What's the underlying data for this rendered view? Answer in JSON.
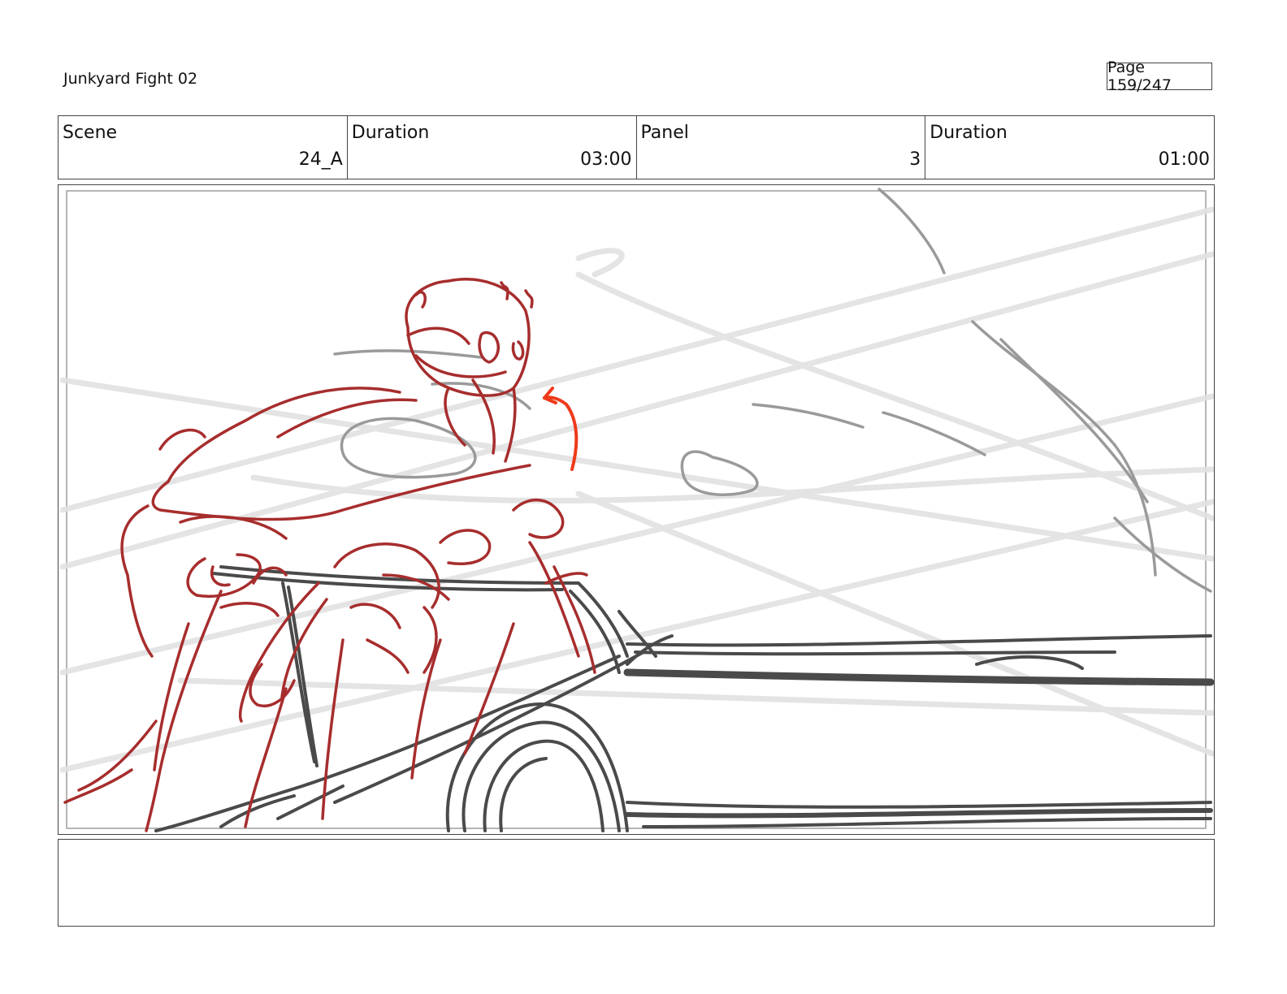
{
  "header": {
    "title": "Junkyard Fight 02",
    "page": "Page 159/247"
  },
  "info": {
    "scene_label": "Scene",
    "scene_value": "24_A",
    "scene_duration_label": "Duration",
    "scene_duration_value": "03:00",
    "panel_label": "Panel",
    "panel_value": "3",
    "panel_duration_label": "Duration",
    "panel_duration_value": "01:00"
  },
  "notes": {
    "text": ""
  },
  "colors": {
    "character_sketch": "#a72d2d",
    "arrow_accent": "#ee3a1a",
    "vehicle_sketch": "#4a4a4a",
    "speed_lines": "#e2e2e2",
    "background_sketch": "#9a9a9a"
  }
}
